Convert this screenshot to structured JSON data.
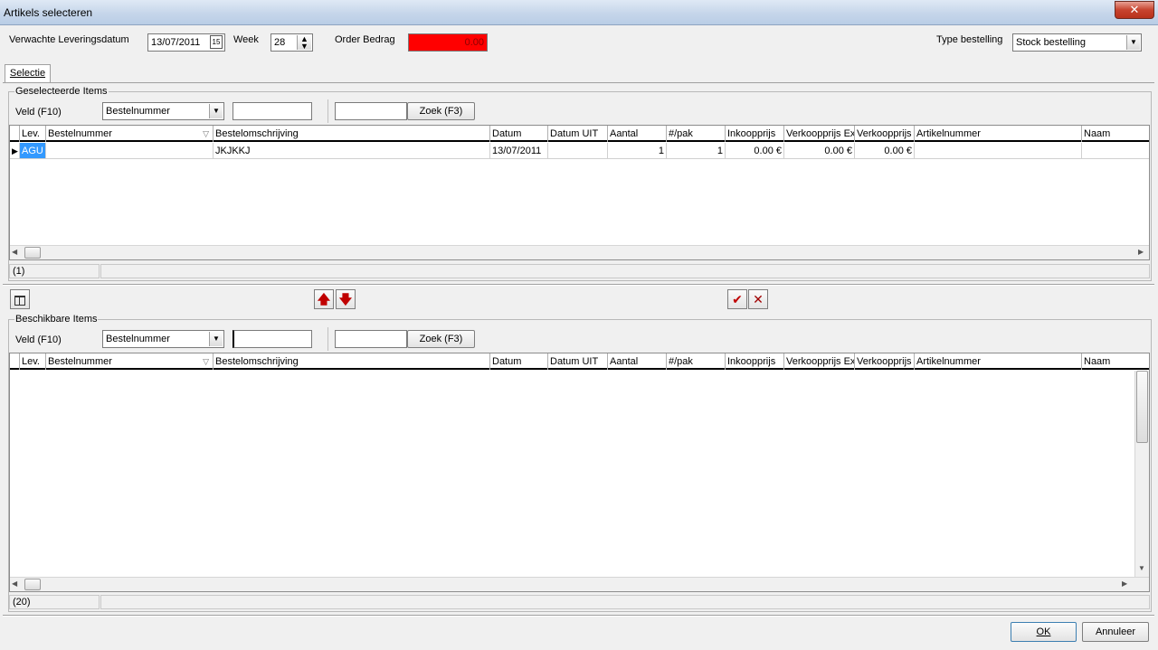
{
  "window": {
    "title": "Artikels selecteren",
    "close_glyph": "✕"
  },
  "header": {
    "delivery_label": "Verwachte Leveringsdatum",
    "delivery_value": "13/07/2011",
    "calendar_glyph": "15",
    "week_label": "Week",
    "week_value": "28",
    "order_label": "Order Bedrag",
    "order_value": "0.00",
    "order_color": "#ff0000",
    "type_label": "Type bestelling",
    "type_value": "Stock bestelling"
  },
  "tabs": [
    {
      "label": "Selectie"
    }
  ],
  "selected": {
    "group_title": "Geselecteerde Items",
    "field_label": "Veld (F10)",
    "field_value": "Bestelnummer",
    "search_value": "",
    "search_value2": "",
    "search_button": "Zoek (F3)",
    "columns": [
      "Lev.",
      "Bestelnummer",
      "Bestelomschrijving",
      "Datum",
      "Datum UIT",
      "Aantal",
      "#/pak",
      "Inkoopprijs",
      "Verkoopprijs Ex",
      "Verkoopprijs",
      "Artikelnummer",
      "Naam"
    ],
    "rows": [
      {
        "lev": "AGU",
        "bestelnummer": "",
        "omschrijving": "JKJKKJ",
        "datum": "13/07/2011",
        "datum_uit": "",
        "aantal": "1",
        "pak": "1",
        "inkoop": "0.00 €",
        "verkoop_ex": "0.00 €",
        "verkoop": "0.00 €",
        "artikelnummer": "",
        "naam": ""
      }
    ],
    "count": "(1)"
  },
  "toolbar": {
    "columns_icon": "columns-icon",
    "up_glyph": "🡅",
    "down_glyph": "🡇",
    "check_glyph": "✔",
    "cross_glyph": "✕",
    "accent": "#c00000"
  },
  "available": {
    "group_title": "Beschikbare Items",
    "field_label": "Veld (F10)",
    "field_value": "Bestelnummer",
    "search_value": "",
    "search_value2": "",
    "search_button": "Zoek (F3)",
    "columns": [
      "Lev.",
      "Bestelnummer",
      "Bestelomschrijving",
      "Datum",
      "Datum UIT",
      "Aantal",
      "#/pak",
      "Inkoopprijs",
      "Verkoopprijs Ex",
      "Verkoopprijs",
      "Artikelnummer",
      "Naam"
    ],
    "count": "(20)"
  },
  "footer": {
    "ok": "OK",
    "cancel": "Annuleer"
  }
}
